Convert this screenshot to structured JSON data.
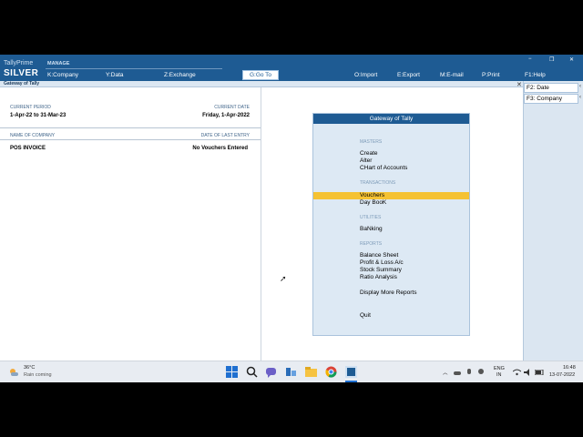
{
  "app": {
    "brand_top": "TallyPrime",
    "brand_edition": "SILVER",
    "manage_label": "MANAGE"
  },
  "top_menu": [
    {
      "label": "K:Company"
    },
    {
      "label": "Y:Data"
    },
    {
      "label": "Z:Exchange"
    },
    {
      "label": "G:Go To"
    },
    {
      "label": "O:Import"
    },
    {
      "label": "E:Export"
    },
    {
      "label": "M:E-mail"
    },
    {
      "label": "P:Print"
    },
    {
      "label": "F1:Help"
    }
  ],
  "window_controls": {
    "minimize": "−",
    "restore": "❐",
    "close": "✕"
  },
  "title_strip": {
    "title": "Gateway of Tally",
    "close": "✕"
  },
  "left_panel": {
    "current_period_label": "CURRENT PERIOD",
    "current_period_value": "1-Apr-22 to 31-Mar-23",
    "current_date_label": "CURRENT DATE",
    "current_date_value": "Friday, 1-Apr-2022",
    "company_name_label": "NAME OF COMPANY",
    "last_entry_label": "DATE OF LAST ENTRY",
    "company_name": "POS INVOICE",
    "last_entry_value": "No Vouchers Entered"
  },
  "gateway": {
    "title": "Gateway of Tally",
    "sections": {
      "masters": "MASTERS",
      "transactions": "TRANSACTIONS",
      "utilities": "UTILITIES",
      "reports": "REPORTS"
    },
    "items": {
      "create": "Create",
      "alter": "Alter",
      "chart": "CHart of Accounts",
      "vouchers": "Vouchers",
      "daybook": "Day BooK",
      "banking": "BaNking",
      "balance_sheet": "Balance Sheet",
      "profit_loss": "Profit & Loss A/c",
      "stock_summary": "Stock Summary",
      "ratio_analysis": "Ratio Analysis",
      "display_more": "Display More Reports",
      "quit": "Quit"
    }
  },
  "right_bar": {
    "date_btn": "F2: Date",
    "company_btn": "F3: Company",
    "arrow": "‹"
  },
  "taskbar": {
    "weather_temp": "36°C",
    "weather_text": "Rain coming",
    "lang_1": "ENG",
    "lang_2": "IN",
    "time": "16:48",
    "date": "13-07-2022"
  }
}
